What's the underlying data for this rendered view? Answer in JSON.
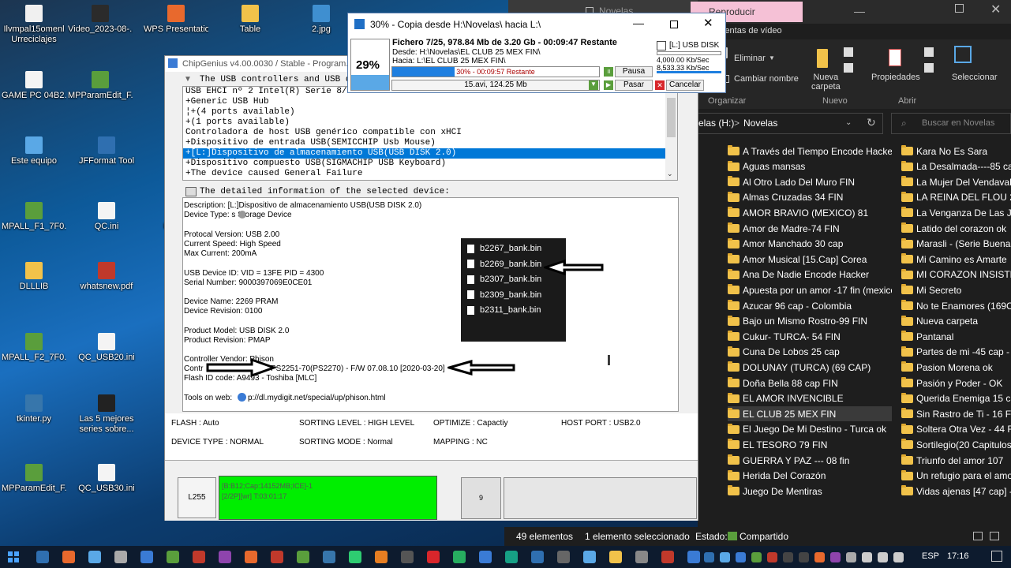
{
  "desktop": {
    "icons": [
      {
        "label": "Ilvmpal15omenl\nUrreciclajes",
        "color": "#f0f0f0"
      },
      {
        "label": "Video_2023-08-...",
        "color": "#2b2b2b"
      },
      {
        "label": "WPS Presentation",
        "color": "#e8692d"
      },
      {
        "label": "Table",
        "color": "#f1c24a"
      },
      {
        "label": "2.jpg",
        "color": "#3f8fd0"
      },
      {
        "label": "GAME PC 04B2...",
        "color": "#f4f4f4"
      },
      {
        "label": "MPParamEdit_F...",
        "color": "#5a9e3c"
      },
      {
        "label": "Este equipo",
        "color": "#5aa8e6"
      },
      {
        "label": "JFFormat Tool",
        "color": "#2f6fb0"
      },
      {
        "label": "Lo...\n(Te...",
        "color": "#777"
      },
      {
        "label": "MPALL_F1_7F0...",
        "color": "#5a9e3c"
      },
      {
        "label": "QC.ini",
        "color": "#f4f4f4"
      },
      {
        "label": "USE...",
        "color": "#777"
      },
      {
        "label": "DLLLIB",
        "color": "#f1c24a"
      },
      {
        "label": "whatsnew.pdf",
        "color": "#c0392b"
      },
      {
        "label": "Sp...",
        "color": "#777"
      },
      {
        "label": "MPALL_F2_7F0...",
        "color": "#5a9e3c"
      },
      {
        "label": "QC_USB20.ini",
        "color": "#f4f4f4"
      },
      {
        "label": "tkinter.py",
        "color": "#3776ab"
      },
      {
        "label": "Las 5 mejores\nseries sobre...",
        "color": "#222"
      },
      {
        "label": "W...",
        "color": "#777"
      },
      {
        "label": "MPParamEdit_F...",
        "color": "#5a9e3c"
      },
      {
        "label": "QC_USB30.ini",
        "color": "#f4f4f4"
      }
    ]
  },
  "explorer": {
    "tab_title": "Novelas",
    "reproducir": "Reproducir",
    "ribbon_subtitle": "ientas de vídeo",
    "ribbon": {
      "eliminar": "Eliminar",
      "cambiar_nombre": "Cambiar nombre",
      "nueva_carpeta": "Nueva\ncarpeta",
      "propiedades": "Propiedades",
      "seleccionar": "Seleccionar",
      "organizar": "Organizar",
      "nuevo": "Nuevo",
      "abrir": "Abrir"
    },
    "breadcrumb_drive": "elas (H:)",
    "breadcrumb_sep": ">",
    "breadcrumb_folder": "Novelas",
    "search_placeholder": "Buscar en Novelas",
    "col1": [
      "A Través del Tiempo Encode Hacker",
      "Aguas mansas",
      "Al Otro Lado Del Muro  FIN",
      "Almas Cruzadas 34 FIN",
      "AMOR BRAVIO (MEXICO) 81",
      "Amor de Madre-74  FIN",
      "Amor Manchado 30 cap",
      "Amor Musical [15.Cap] Corea",
      "Ana De Nadie Encode Hacker",
      "Apuesta por un amor -17 fin (mexico)",
      "Azucar  96 cap - Colombia",
      "Bajo un Mismo Rostro-99 FIN",
      "Cukur-  TURCA-  54 FIN",
      "Cuna De Lobos 25 cap",
      "DOLUNAY (TURCA) (69 CAP)",
      "Doña Bella  88 cap FIN",
      "EL AMOR INVENCIBLE",
      "EL CLUB  25 MEX FIN",
      "El Juego De Mi Destino - Turca ok",
      "EL TESORO 79 FIN",
      "GUERRA Y PAZ --- 08 fin",
      "Herida Del Corazón",
      "Juego De Mentiras"
    ],
    "col2": [
      "Kara No Es Sara",
      "La Desalmada----85 cap",
      "La Mujer Del Vendaval",
      "LA REINA DEL FLOU 2",
      "La Venganza De Las Juan...",
      "Latido del corazon ok",
      "Marasli - (Serie Buenaa)",
      "Mi Camino es Amarte",
      "MI CORAZON INSISTE o...",
      "Mi Secreto",
      "No te Enamores (169Cap)",
      "Nueva carpeta",
      "Pantanal",
      "Partes de mi -45 cap - B...",
      "Pasion Morena ok",
      "Pasión y Poder - OK",
      "Querida Enemiga 15 cap",
      "Sin Rastro de Ti - 16 Fin",
      "Soltera Otra Vez - 44 Fin",
      "Sortilegio(20 Capitulos)",
      "Triunfo del amor 107",
      "Un refugio para el amor",
      "Vidas ajenas [47 cap] - B..."
    ],
    "selected_index": 17,
    "status": {
      "count": "49 elementos",
      "selected": "1 elemento seleccionado",
      "estado_label": "Estado:",
      "estado_value": "Compartido"
    }
  },
  "copy_dialog": {
    "title": "30% - Copia desde H:\\Novelas\\ hacia L:\\",
    "percent": "29%",
    "file_line": "Fichero 7/25, 978.84 Mb de 3.20 Gb - 00:09:47 Restante",
    "desde": "Desde: H:\\Novelas\\EL CLUB  25 MEX FIN\\",
    "hacia": "Hacia:  L:\\EL CLUB  25 MEX FIN\\",
    "progress_text": "30% - 00:09:57 Restante",
    "progress_fraction": 0.3,
    "current_file": "15.avi, 124.25 Mb",
    "drive": "[L:] USB DISK",
    "speed1": "4,000.00 Kb/Sec",
    "speed2": "8,533.33 Kb/Sec",
    "pausa": "Pausa",
    "pasar": "Pasar",
    "cancelar": "Cancelar"
  },
  "chipgenius": {
    "title": "ChipGenius v4.00.0030 / Stable - Program...",
    "section1": "The USB controllers and USB device",
    "devices": [
      "USB EHCI nº 2 Intel(R) Serie 8/C220 USB - 9C26",
      "+Generic USB Hub",
      "¦+(4 ports available)",
      "+(1 ports available)",
      "Controladora de host USB genérico compatible con xHCI",
      "+Dispositivo de entrada USB(SEMICCHIP Usb Mouse)",
      "+[L:]Dispositivo de almacenamiento USB(USB DISK 2.0)",
      "+Dispositivo compuesto USB(SIGMACHIP USB Keyboard)",
      "+The device caused General Failure"
    ],
    "selected_device": 6,
    "section2": "The detailed information of the selected device:",
    "info": {
      "description": "Description: [L:]Dispositivo de almacenamiento USB(USB DISK 2.0)",
      "device_type": "Device Type:     s Storage Device",
      "protocal": "Protocal Version: USB 2.00",
      "speed": "Current Speed: High Speed",
      "current": "Max Current: 200mA",
      "vidpid": "USB Device ID: VID = 13FE PID = 4300",
      "serial": "Serial Number: 9000397069E0CE01",
      "dev_name": "Device Name: 2269 PRAM",
      "dev_rev": "Device Revision: 0100",
      "prod_model": "Product Model: USB DISK 2.0",
      "prod_rev": "Product Revision: PMAP",
      "ctrl_vendor": "Controller Vendor: Phison",
      "ctrl_part_prefix": "Contr",
      "ctrl_part": "PS2251-70(PS2270) - F/W 07.08.10 [2020-03-20]",
      "flash_id": "Flash ID code:      A9493 - Toshiba [MLC]",
      "tools_label": "Tools on web:",
      "tools_url": "p://dl.mydigit.net/special/up/phison.html"
    },
    "bins": [
      "b2267_bank.bin",
      "b2269_bank.bin",
      "b2307_bank.bin",
      "b2309_bank.bin",
      "b2311_bank.bin"
    ],
    "params": {
      "flash": "FLASH : Auto",
      "sorting_level": "SORTING LEVEL : HIGH LEVEL",
      "optimize": "OPTIMIZE : Capactiy",
      "host_port": "HOST PORT : USB2.0",
      "device_type": "DEVICE TYPE : NORMAL",
      "sorting_mode": "SORTING MODE : Normal",
      "mapping": "MAPPING : NC"
    },
    "slot_label": "L255",
    "slot_line1": "[B:B12;Cap:14152MB;ICE]-1",
    "slot_line2": "[2/2P][wr] T:03:01:17",
    "slot_num": "9"
  },
  "taskbar": {
    "lang": "ESP",
    "time": "17:16"
  },
  "colors": {
    "green": "#00ee00",
    "selection": "#0078d7",
    "progress": "#1e7fe0"
  }
}
